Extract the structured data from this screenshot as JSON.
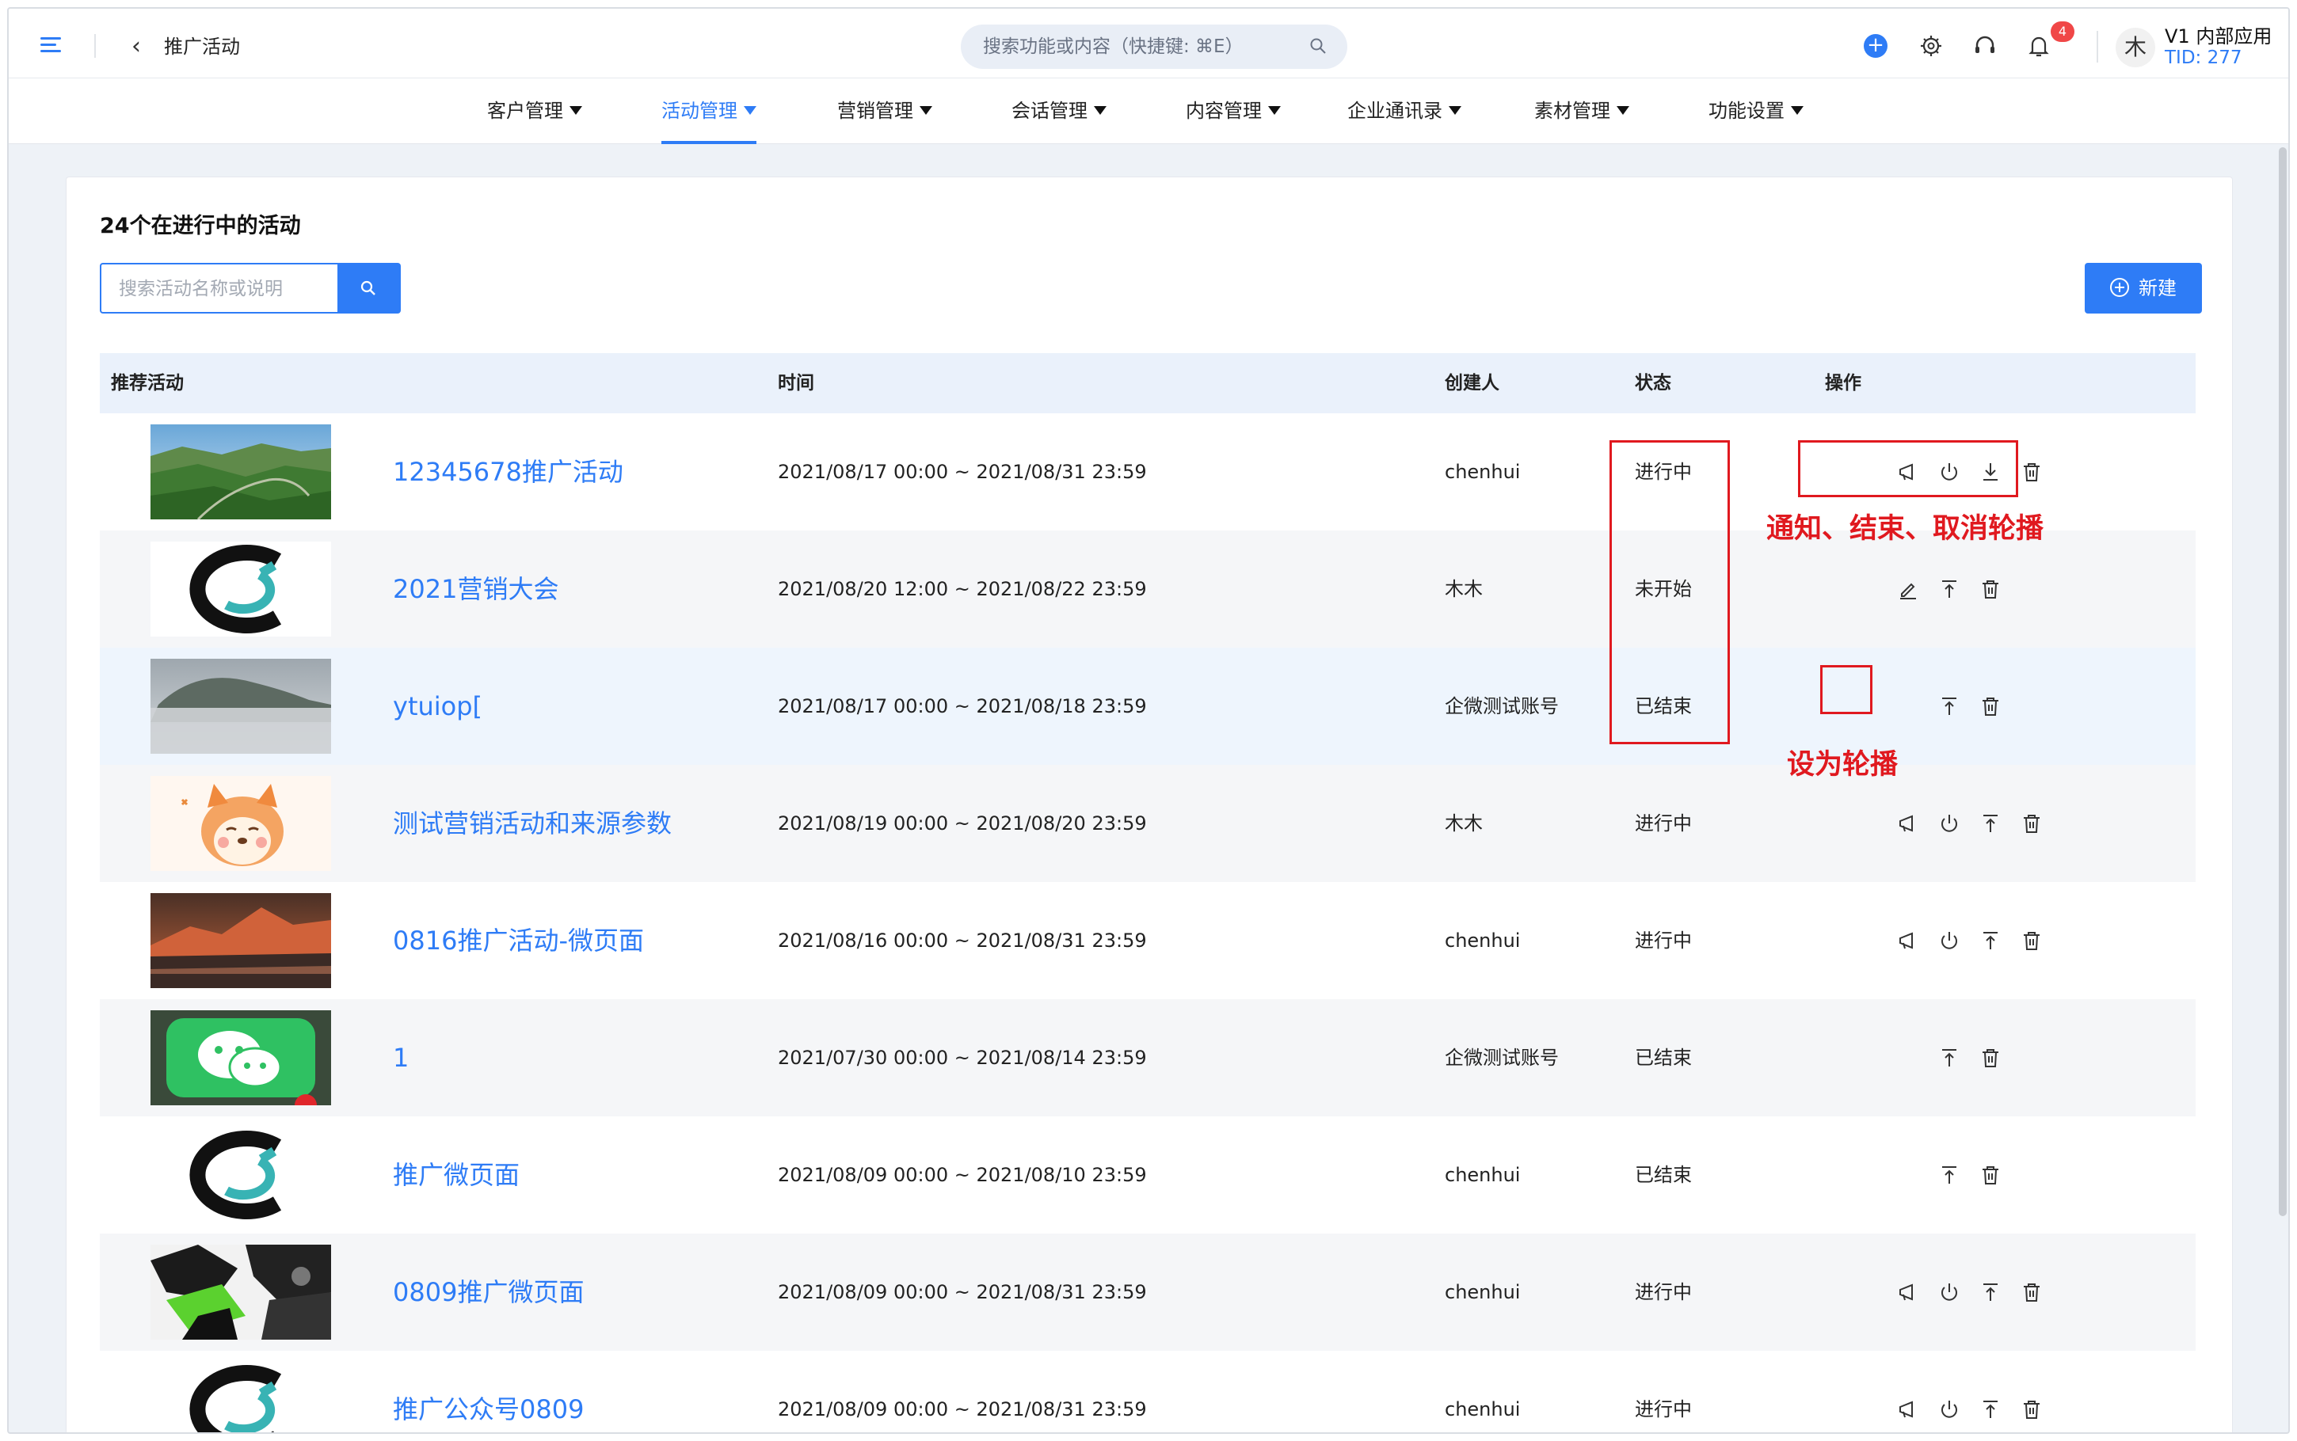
{
  "header": {
    "breadcrumb": "推广活动",
    "search_placeholder": "搜索功能或内容（快捷键: ⌘E）",
    "notification_count": "4",
    "avatar_char": "木",
    "app_name": "V1 内部应用",
    "tid": "TID: 277"
  },
  "nav": [
    {
      "label": "客户管理"
    },
    {
      "label": "活动管理"
    },
    {
      "label": "营销管理"
    },
    {
      "label": "会话管理"
    },
    {
      "label": "内容管理"
    },
    {
      "label": "企业通讯录"
    },
    {
      "label": "素材管理"
    },
    {
      "label": "功能设置"
    }
  ],
  "nav_active": "活动管理",
  "card": {
    "title": "24个在进行中的活动",
    "search_placeholder": "搜索活动名称或说明",
    "new_button": "新建"
  },
  "table": {
    "headers": {
      "activity": "推荐活动",
      "time": "时间",
      "creator": "创建人",
      "status": "状态",
      "actions": "操作"
    },
    "rows": [
      {
        "name": "12345678推广活动",
        "time": "2021/08/17 00:00 ~ 2021/08/31 23:59",
        "creator": "chenhui",
        "status": "进行中",
        "thumb": "mountain-valley",
        "actions": [
          "notify-icon",
          "power-icon",
          "download-icon",
          "trash-icon"
        ]
      },
      {
        "name": "2021营销大会",
        "time": "2021/08/20 12:00 ~ 2021/08/22 23:59",
        "creator": "木木",
        "status": "未开始",
        "thumb": "c-logo",
        "actions": [
          "edit-icon",
          "pin-top-icon",
          "trash-icon"
        ]
      },
      {
        "name": "ytuiop[",
        "time": "2021/08/17 00:00 ~ 2021/08/18 23:59",
        "creator": "企微测试账号",
        "status": "已结束",
        "thumb": "misty-mountain",
        "actions": [
          "pin-top-icon",
          "trash-icon"
        ]
      },
      {
        "name": "测试营销活动和来源参数",
        "time": "2021/08/19 00:00 ~ 2021/08/20 23:59",
        "creator": "木木",
        "status": "进行中",
        "thumb": "shiba-cartoon",
        "actions": [
          "notify-icon",
          "power-icon",
          "pin-top-icon",
          "trash-icon"
        ]
      },
      {
        "name": "0816推广活动-微页面",
        "time": "2021/08/16 00:00 ~ 2021/08/31 23:59",
        "creator": "chenhui",
        "status": "进行中",
        "thumb": "sunset-peaks",
        "actions": [
          "notify-icon",
          "power-icon",
          "pin-top-icon",
          "trash-icon"
        ]
      },
      {
        "name": "1",
        "time": "2021/07/30 00:00 ~ 2021/08/14 23:59",
        "creator": "企微测试账号",
        "status": "已结束",
        "thumb": "wechat-logo",
        "actions": [
          "pin-top-icon",
          "trash-icon"
        ]
      },
      {
        "name": "推广微页面",
        "time": "2021/08/09 00:00 ~ 2021/08/10 23:59",
        "creator": "chenhui",
        "status": "已结束",
        "thumb": "c-logo",
        "actions": [
          "pin-top-icon",
          "trash-icon"
        ]
      },
      {
        "name": "0809推广微页面",
        "time": "2021/08/09 00:00 ~ 2021/08/31 23:59",
        "creator": "chenhui",
        "status": "进行中",
        "thumb": "green-art",
        "actions": [
          "notify-icon",
          "power-icon",
          "pin-top-icon",
          "trash-icon"
        ]
      },
      {
        "name": "推广公众号0809",
        "time": "2021/08/09 00:00 ~ 2021/08/31 23:59",
        "creator": "chenhui",
        "status": "进行中",
        "thumb": "c-logo",
        "actions": [
          "notify-icon",
          "power-icon",
          "pin-top-icon",
          "trash-icon"
        ]
      }
    ]
  },
  "annotations": {
    "ops_note": "通知、结束、取消轮播",
    "carousel_note": "设为轮播"
  },
  "colors": {
    "accent": "#2e7cf6",
    "annotation": "#e0191f"
  }
}
